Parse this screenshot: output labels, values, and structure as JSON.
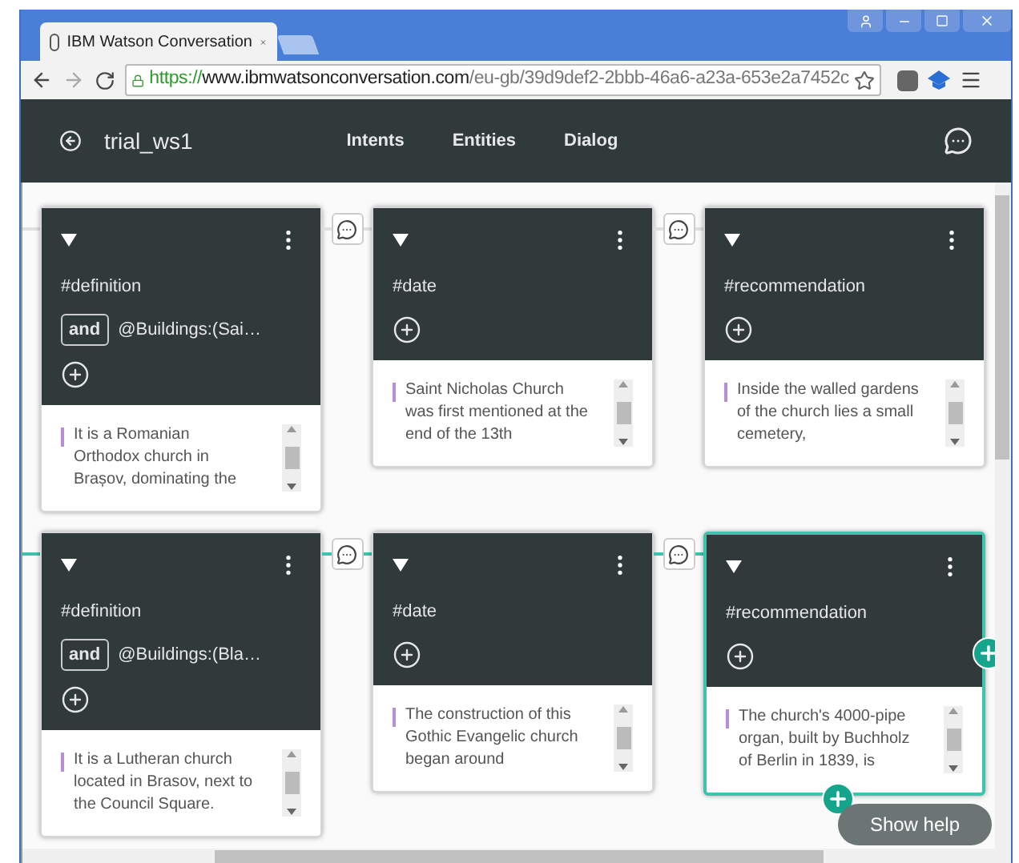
{
  "browser": {
    "tab_title": "IBM Watson Conversation",
    "url": {
      "scheme": "https://",
      "host": "www.ibmwatsonconversation.com",
      "path": "/eu-gb/39d9def2-2bbb-46a6-a23a-653e2a7452c"
    }
  },
  "app": {
    "workspace": "trial_ws1",
    "nav": [
      {
        "label": "Intents"
      },
      {
        "label": "Entities"
      },
      {
        "label": "Dialog"
      }
    ]
  },
  "rows": [
    {
      "active": false,
      "nodes": [
        {
          "condition": "#definition",
          "and_label": "and",
          "and_condition": "@Buildings:(Sai…",
          "response": "It is a Romanian Orthodox church in Brașov, dominating the",
          "selected": false
        },
        {
          "condition": "#date",
          "response": "Saint Nicholas Church was first mentioned at the end of the 13th",
          "selected": false
        },
        {
          "condition": "#recommendation",
          "response": "Inside the walled gardens of the church lies a small cemetery,",
          "selected": false
        }
      ]
    },
    {
      "active": true,
      "nodes": [
        {
          "condition": "#definition",
          "and_label": "and",
          "and_condition": "@Buildings:(Bla…",
          "response": "It is a Lutheran church located in Brasov, next to the Council Square.",
          "selected": false
        },
        {
          "condition": "#date",
          "response": "The construction of this Gothic Evangelic church began around",
          "selected": false
        },
        {
          "condition": "#recommendation",
          "response": "The church's 4000-pipe organ, built by Buchholz of Berlin in 1839, is",
          "selected": true
        }
      ]
    }
  ],
  "help_button": "Show help"
}
